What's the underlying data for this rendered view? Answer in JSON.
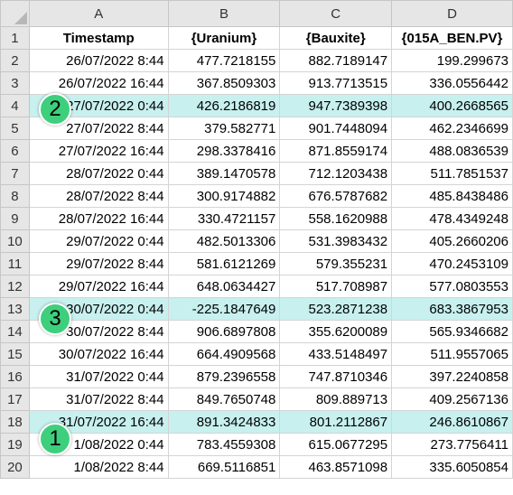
{
  "columns": [
    "A",
    "B",
    "C",
    "D"
  ],
  "headers": [
    "Timestamp",
    "{Uranium}",
    "{Bauxite}",
    "{015A_BEN.PV}"
  ],
  "header_row_number": "1",
  "rows": [
    {
      "n": "2",
      "ts": "26/07/2022 8:44",
      "b": "477.7218155",
      "c": "882.7189147",
      "d": "199.299673",
      "hl": false
    },
    {
      "n": "3",
      "ts": "26/07/2022 16:44",
      "b": "367.8509303",
      "c": "913.7713515",
      "d": "336.0556442",
      "hl": false
    },
    {
      "n": "4",
      "ts": "27/07/2022 0:44",
      "b": "426.2186819",
      "c": "947.7389398",
      "d": "400.2668565",
      "hl": true
    },
    {
      "n": "5",
      "ts": "27/07/2022 8:44",
      "b": "379.582771",
      "c": "901.7448094",
      "d": "462.2346699",
      "hl": false
    },
    {
      "n": "6",
      "ts": "27/07/2022 16:44",
      "b": "298.3378416",
      "c": "871.8559174",
      "d": "488.0836539",
      "hl": false
    },
    {
      "n": "7",
      "ts": "28/07/2022 0:44",
      "b": "389.1470578",
      "c": "712.1203438",
      "d": "511.7851537",
      "hl": false
    },
    {
      "n": "8",
      "ts": "28/07/2022 8:44",
      "b": "300.9174882",
      "c": "676.5787682",
      "d": "485.8438486",
      "hl": false
    },
    {
      "n": "9",
      "ts": "28/07/2022 16:44",
      "b": "330.4721157",
      "c": "558.1620988",
      "d": "478.4349248",
      "hl": false
    },
    {
      "n": "10",
      "ts": "29/07/2022 0:44",
      "b": "482.5013306",
      "c": "531.3983432",
      "d": "405.2660206",
      "hl": false
    },
    {
      "n": "11",
      "ts": "29/07/2022 8:44",
      "b": "581.6121269",
      "c": "579.355231",
      "d": "470.2453109",
      "hl": false
    },
    {
      "n": "12",
      "ts": "29/07/2022 16:44",
      "b": "648.0634427",
      "c": "517.708987",
      "d": "577.0803553",
      "hl": false
    },
    {
      "n": "13",
      "ts": "30/07/2022 0:44",
      "b": "-225.1847649",
      "c": "523.2871238",
      "d": "683.3867953",
      "hl": true
    },
    {
      "n": "14",
      "ts": "30/07/2022 8:44",
      "b": "906.6897808",
      "c": "355.6200089",
      "d": "565.9346682",
      "hl": false
    },
    {
      "n": "15",
      "ts": "30/07/2022 16:44",
      "b": "664.4909568",
      "c": "433.5148497",
      "d": "511.9557065",
      "hl": false
    },
    {
      "n": "16",
      "ts": "31/07/2022 0:44",
      "b": "879.2396558",
      "c": "747.8710346",
      "d": "397.2240858",
      "hl": false
    },
    {
      "n": "17",
      "ts": "31/07/2022 8:44",
      "b": "849.7650748",
      "c": "809.889713",
      "d": "409.2567136",
      "hl": false
    },
    {
      "n": "18",
      "ts": "31/07/2022 16:44",
      "b": "891.3424833",
      "c": "801.2112867",
      "d": "246.8610867",
      "hl": true
    },
    {
      "n": "19",
      "ts": "1/08/2022 0:44",
      "b": "783.4559308",
      "c": "615.0677295",
      "d": "273.7756411",
      "hl": false
    },
    {
      "n": "20",
      "ts": "1/08/2022 8:44",
      "b": "669.5116851",
      "c": "463.8571098",
      "d": "335.6050854",
      "hl": false
    }
  ],
  "badges": {
    "row4": "2",
    "row13": "3",
    "row18": "1"
  },
  "colors": {
    "highlight": "#c7f0ef",
    "badge": "#3ecf7d",
    "header_bg": "#e6e6e6",
    "grid": "#d4d4d4"
  }
}
